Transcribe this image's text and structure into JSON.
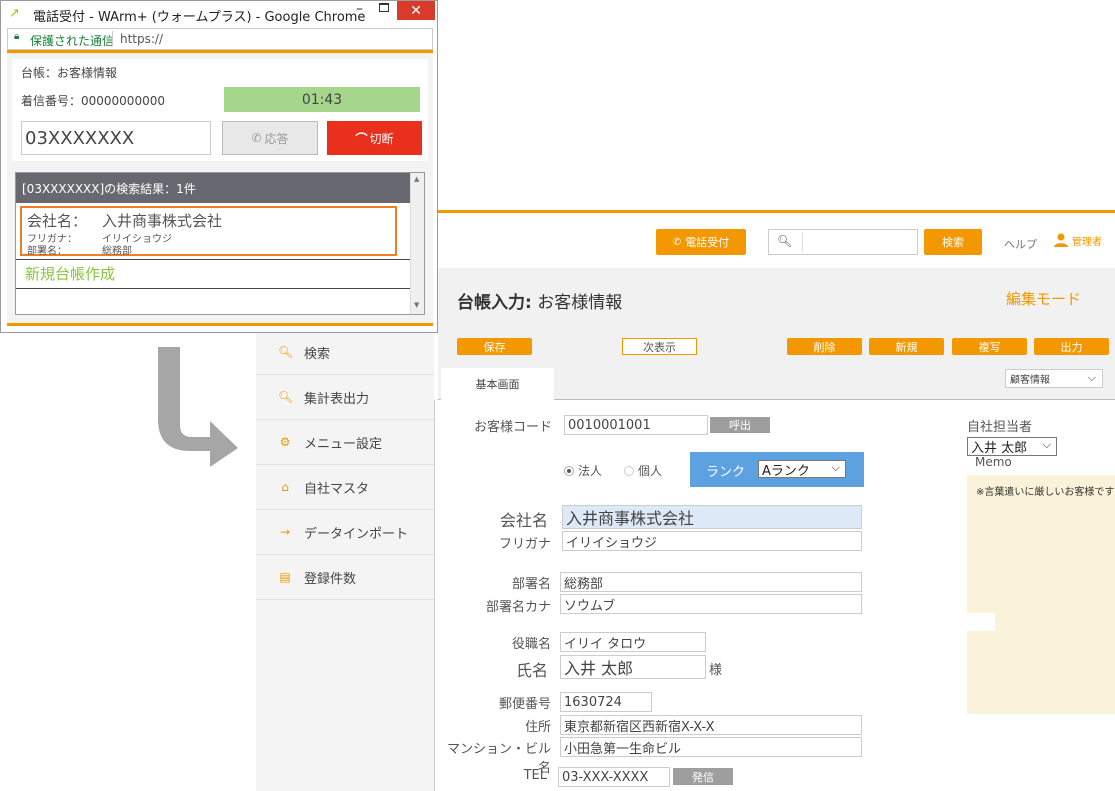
{
  "main": {
    "header": {
      "phone_button": "電話受付",
      "search_placeholder": "",
      "search_button": "検索",
      "help": "ヘルプ",
      "user": "管理者"
    },
    "title": {
      "bold": "台帳入力:",
      "rest": "お客様情報",
      "mode": "編集モード"
    },
    "toolbar": {
      "save": "保存",
      "next": "次表示",
      "delete": "削除",
      "new": "新規",
      "copy": "複写",
      "output": "出力"
    },
    "tabs": {
      "basic": "基本画面",
      "view_select": "顧客情報"
    },
    "sidebar": [
      {
        "icon": "search-icon",
        "label": "検索"
      },
      {
        "icon": "search-icon",
        "label": "集計表出力"
      },
      {
        "icon": "gear-icon",
        "label": "メニュー設定"
      },
      {
        "icon": "home-icon",
        "label": "自社マスタ"
      },
      {
        "icon": "import-icon",
        "label": "データインポート"
      },
      {
        "icon": "document-icon",
        "label": "登録件数"
      }
    ],
    "form": {
      "customer_code_label": "お客様コード",
      "customer_code": "0010001001",
      "call_button": "呼出",
      "corp_label": "法人",
      "individual_label": "個人",
      "rank_label": "ランク",
      "rank_value": "Aランク",
      "company_label": "会社名",
      "company": "入井商事株式会社",
      "furigana_label": "フリガナ",
      "furigana": "イリイショウジ",
      "dept_label": "部署名",
      "dept": "総務部",
      "dept_kana_label": "部署名カナ",
      "dept_kana": "ソウムブ",
      "title_label": "役職名",
      "title": "イリイ タロウ",
      "name_label": "氏名",
      "name": "入井 太郎",
      "honorific": "様",
      "zip_label": "郵便番号",
      "zip": "1630724",
      "address_label": "住所",
      "address": "東京都新宿区西新宿X-X-X",
      "building_label": "マンション・ビル名",
      "building": "小田急第一生命ビル",
      "tel_label": "TEL",
      "tel": "03-XXX-XXXX",
      "dial_button": "発信",
      "staff_label": "自社担当者",
      "staff_value": "入井 太郎",
      "memo_label": "Memo",
      "memo_text": "※言葉遣いに厳しいお客様です"
    }
  },
  "popup": {
    "window_title": "電話受付 - WArm+ (ウォームプラス) - Google Chrome",
    "secure_label": "保護された通信",
    "url": "https://",
    "ledger": "台帳：お客様情報",
    "incoming": "着信番号：00000000000",
    "timer": "01:43",
    "phone_input": "03XXXXXXX",
    "answer": "応答",
    "hangup": "切断",
    "results_header": "[03XXXXXXX]の検索結果：1件",
    "result": {
      "company_label": "会社名：",
      "company": "入井商事株式会社",
      "furigana_label": "フリガナ：",
      "furigana": "イリイショウジ",
      "dept_label": "部署名：",
      "dept": "総務部"
    },
    "new_ledger": "新規台帳作成"
  },
  "colors": {
    "accent": "#f39800",
    "timer_bg": "#a6d58c",
    "hangup": "#e8301c",
    "rank_bg": "#5ea1e0",
    "memo_bg": "#faf3d9"
  }
}
